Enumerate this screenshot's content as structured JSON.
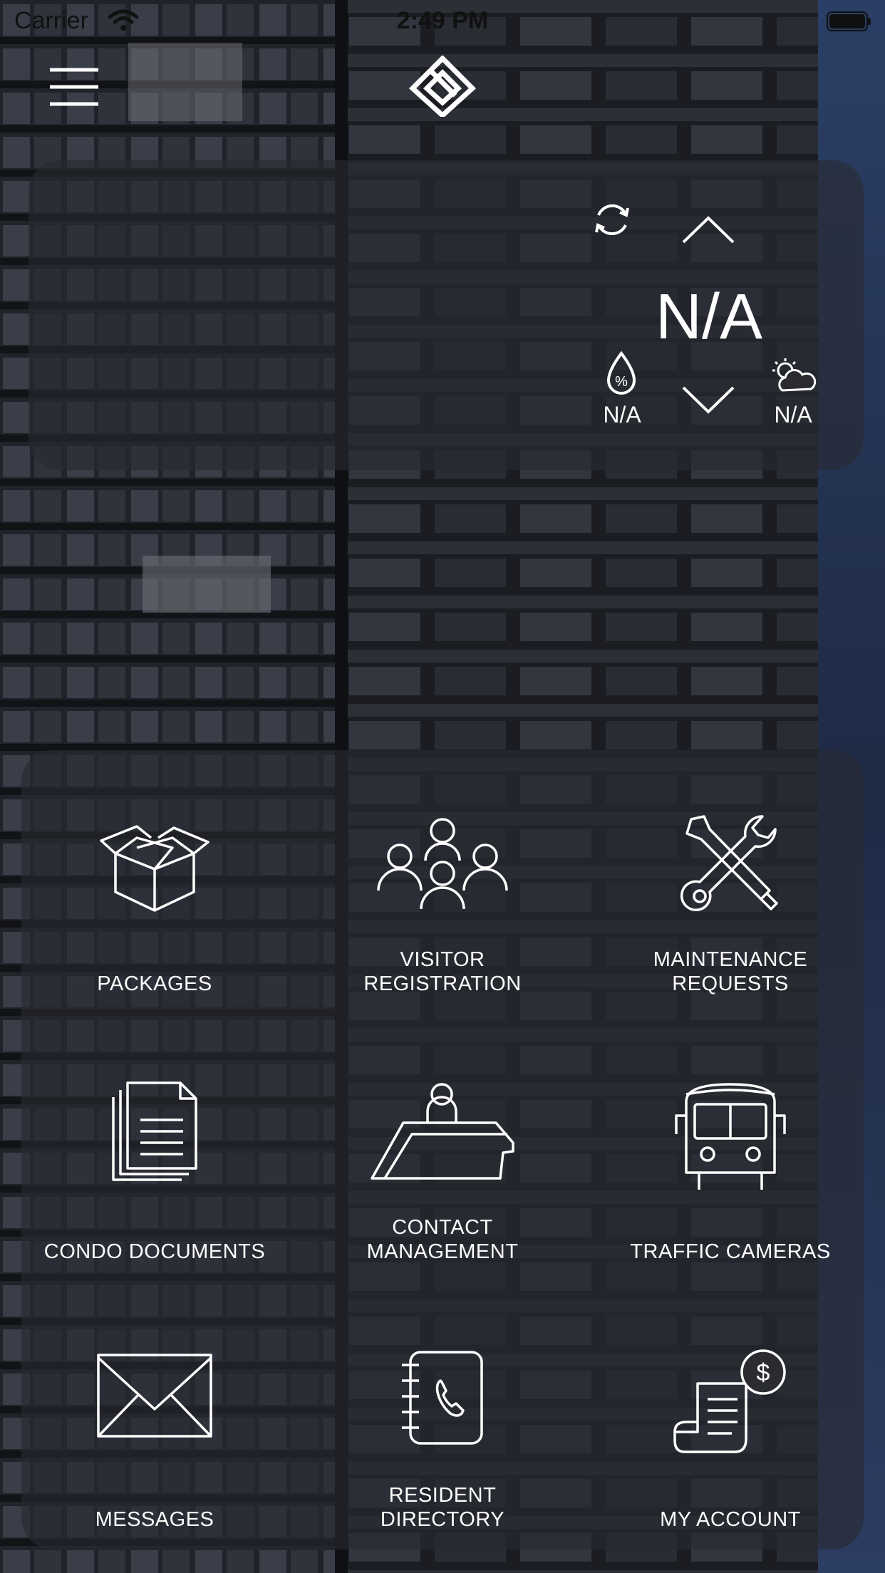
{
  "status_bar": {
    "carrier": "Carrier",
    "time": "2:49 PM"
  },
  "weather": {
    "temperature": "N/A",
    "humidity": "N/A",
    "condition": "N/A",
    "humidity_icon": "humidity-drop-icon",
    "condition_icon": "partly-cloudy-icon"
  },
  "menu": {
    "items": [
      {
        "label": "PACKAGES",
        "icon": "package-box-icon"
      },
      {
        "label": "VISITOR\nREGISTRATION",
        "icon": "visitors-group-icon"
      },
      {
        "label": "MAINTENANCE\nREQUESTS",
        "icon": "tools-icon"
      },
      {
        "label": "CONDO DOCUMENTS",
        "icon": "documents-icon"
      },
      {
        "label": "CONTACT\nMANAGEMENT",
        "icon": "front-desk-icon"
      },
      {
        "label": "TRAFFIC CAMERAS",
        "icon": "bus-icon"
      },
      {
        "label": "MESSAGES",
        "icon": "envelope-icon"
      },
      {
        "label": "RESIDENT\nDIRECTORY",
        "icon": "phone-book-icon"
      },
      {
        "label": "MY ACCOUNT",
        "icon": "billing-icon"
      }
    ]
  },
  "colors": {
    "card_bg": "#2a2c32",
    "icon_stroke": "#ffffff"
  }
}
